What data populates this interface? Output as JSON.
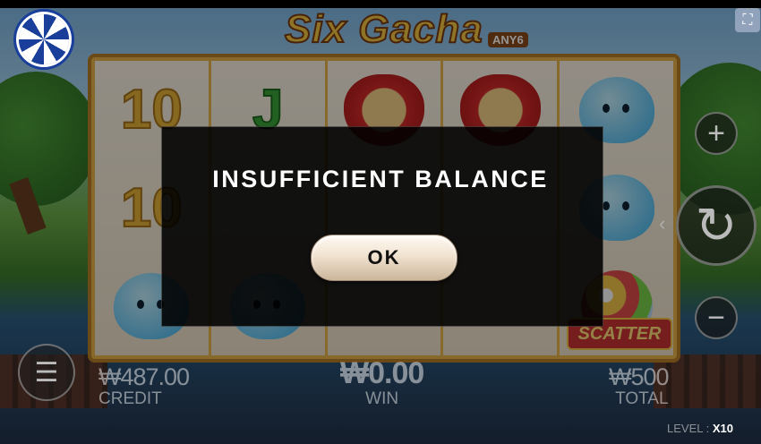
{
  "game": {
    "title": "Six Gacha",
    "title_badge": "ANY6",
    "scatter_label": "SCATTER",
    "reels": [
      [
        "10",
        "10",
        "blob"
      ],
      [
        "J",
        "",
        "blob"
      ],
      [
        "bear",
        "",
        ""
      ],
      [
        "bear",
        "",
        ""
      ],
      [
        "blob",
        "blob",
        "gumball"
      ]
    ]
  },
  "hud": {
    "credit_value": "₩487.00",
    "credit_label": "CREDIT",
    "win_value": "₩0.00",
    "win_label": "WIN",
    "total_value": "₩500",
    "total_label": "TOTAL",
    "level_label": "LEVEL : ",
    "level_value": "X10"
  },
  "controls": {
    "plus_glyph": "+",
    "minus_glyph": "−",
    "spin_glyph": "↻",
    "menu_glyph": "☰",
    "fullscreen_glyph": "⛶",
    "spin_arrow_glyph": "‹"
  },
  "dialog": {
    "message": "INSUFFICIENT BALANCE",
    "ok_label": "OK"
  },
  "colors": {
    "title": "#f7c944",
    "modal_bg": "#000000",
    "ok_button": "#f1e3d1"
  }
}
